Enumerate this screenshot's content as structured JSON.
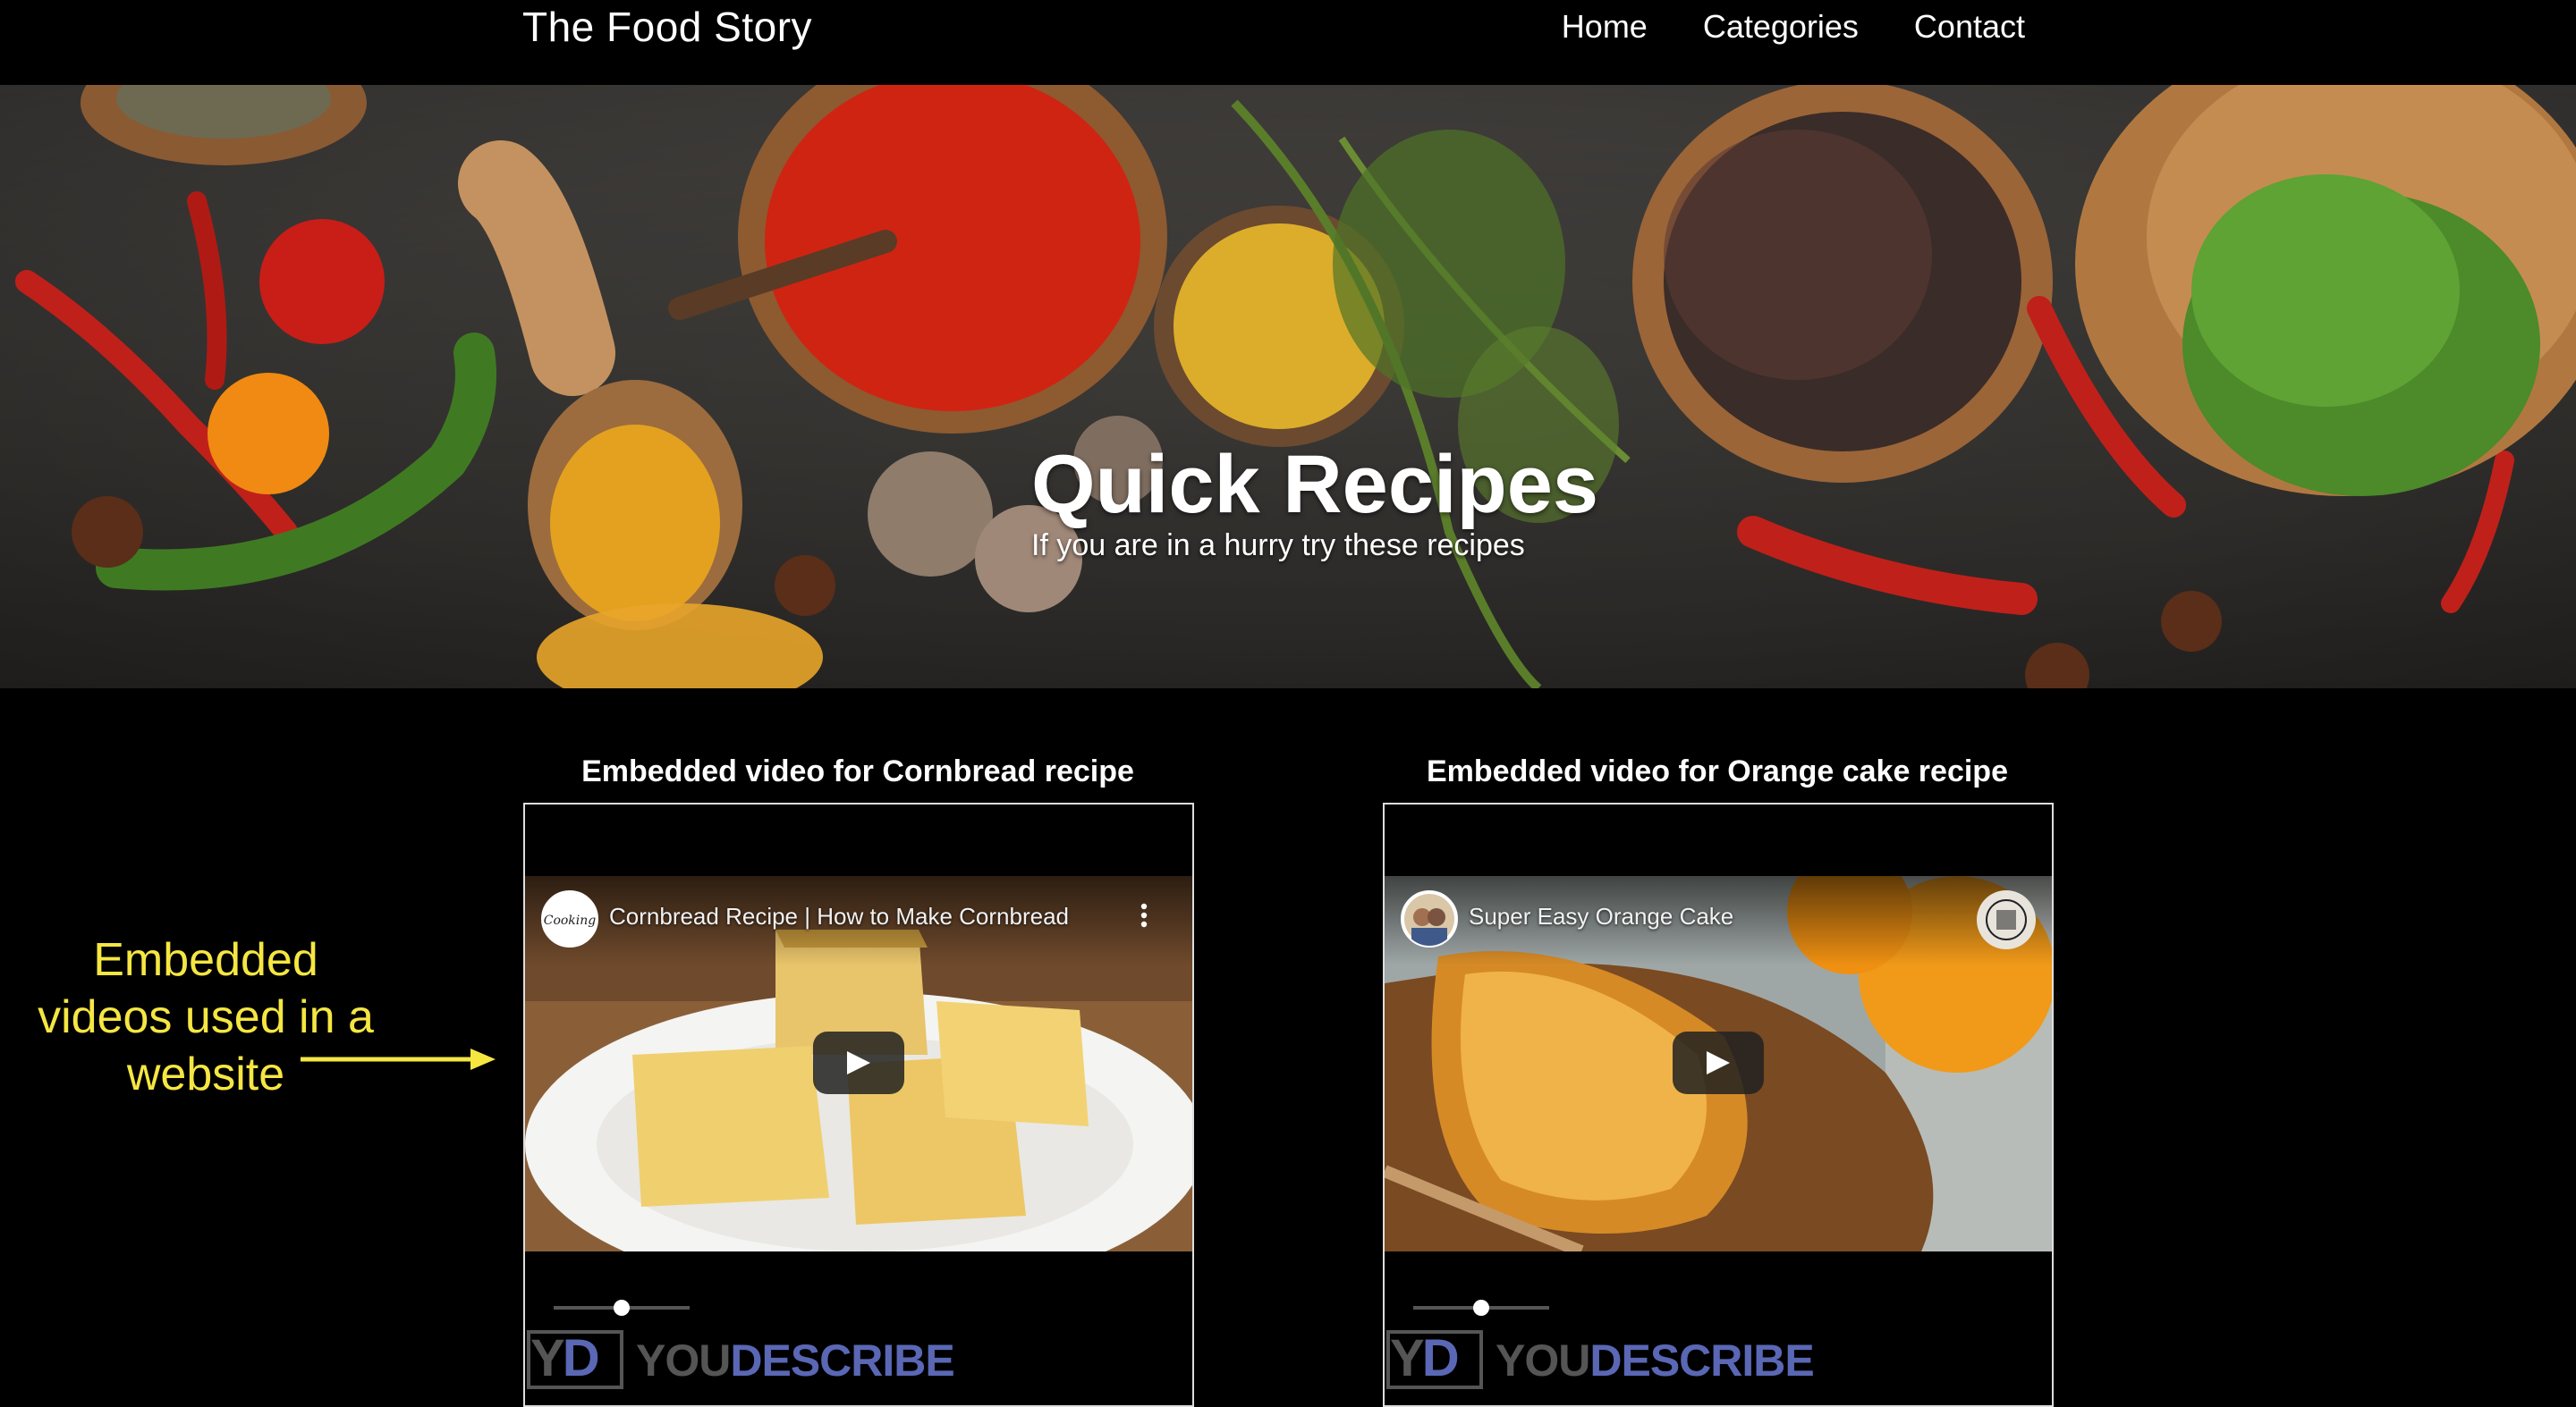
{
  "header": {
    "brand": "The Food Story",
    "nav": [
      "Home",
      "Categories",
      "Contact"
    ]
  },
  "hero": {
    "title": "Quick Recipes",
    "subtitle": "If you are in a hurry try these recipes"
  },
  "videos": [
    {
      "heading": "Embedded video for Cornbread recipe",
      "video_title": "Cornbread Recipe | How to Make Cornbread",
      "slider_value": 0.5,
      "logo_you": "YOU",
      "logo_describe": "DESCRIBE",
      "logo_y": "Y",
      "logo_d": "D"
    },
    {
      "heading": "Embedded video for Orange cake recipe",
      "video_title": "Super Easy Orange Cake",
      "slider_value": 0.5,
      "logo_you": "YOU",
      "logo_describe": "DESCRIBE",
      "logo_y": "Y",
      "logo_d": "D"
    }
  ],
  "annotation": {
    "text_line1": "Embedded",
    "text_line2": "videos used in a",
    "text_line3": "website"
  },
  "colors": {
    "accent_annotation": "#f5e642",
    "youdescribe_blue": "#5a67b4",
    "youdescribe_gray": "#555555"
  },
  "icons": [
    "play-icon",
    "more-vert-icon",
    "arrow-right-icon"
  ]
}
